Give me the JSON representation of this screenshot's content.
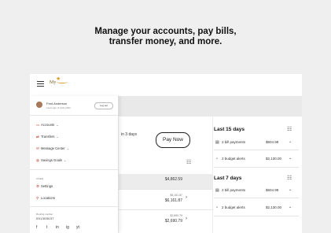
{
  "headline": {
    "line1": "Manage your accounts, pay bills,",
    "line2": "transfer money, and more."
  },
  "logo": {
    "text": "My"
  },
  "user": {
    "name": "Fred Anderson",
    "last_login": "Last login: 8 AUG 2022",
    "logout_label": "Log out"
  },
  "nav": [
    {
      "label": "Accounts",
      "icon": "accounts-icon"
    },
    {
      "label": "Transfers",
      "icon": "transfers-icon"
    },
    {
      "label": "Message Center",
      "icon": "message-icon"
    },
    {
      "label": "Savings Goals",
      "icon": "savings-icon"
    }
  ],
  "section_label": "USER",
  "settings": [
    {
      "label": "Settings",
      "icon": "gear-icon"
    },
    {
      "label": "Locations",
      "icon": "location-pin-icon"
    }
  ],
  "routing": {
    "label": "Routing number",
    "value": "091305037"
  },
  "social": [
    "f",
    "t",
    "in",
    "ig",
    "yt"
  ],
  "pay": {
    "text": "in 3 days",
    "button": "Pay Now"
  },
  "accounts": [
    {
      "amount": "$4,862.59",
      "sub": ""
    },
    {
      "amount": "$6,161.87",
      "sub": "$5,161.87"
    },
    {
      "amount": "$2,690.79",
      "sub": "$2,890.79"
    }
  ],
  "last15": {
    "title": "Last 15 days",
    "items": [
      {
        "icon": "bill-icon",
        "label": "2 bill payments",
        "value": "$604.99"
      },
      {
        "icon": "budget-icon",
        "label": "2 budget alerts",
        "value": "$2,130.00"
      }
    ]
  },
  "last7": {
    "title": "Last 7 days",
    "items": [
      {
        "icon": "bill-icon",
        "label": "2 bill payments",
        "value": "$604.99"
      },
      {
        "icon": "budget-icon",
        "label": "2 budget alerts",
        "value": "$2,130.00"
      }
    ]
  }
}
